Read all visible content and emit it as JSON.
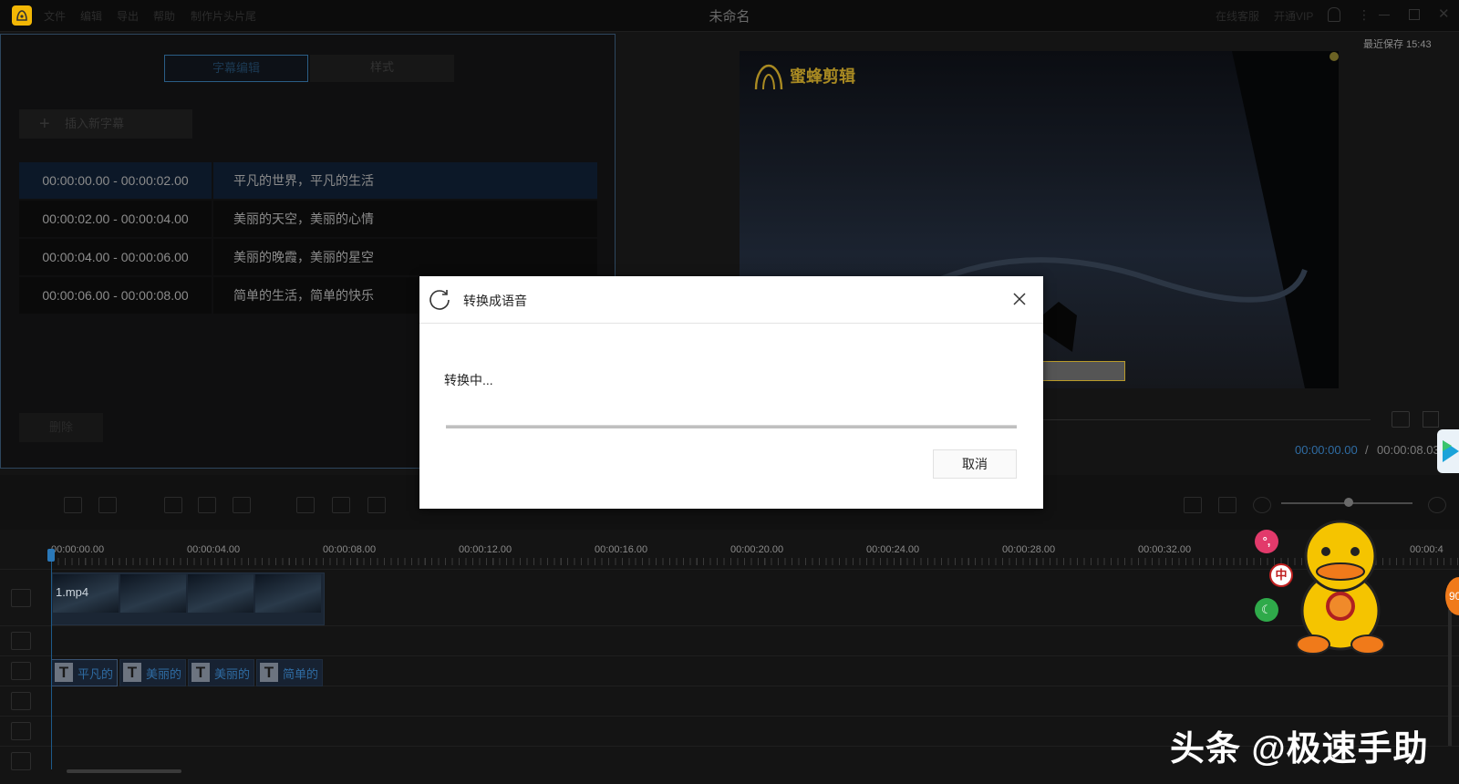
{
  "app": {
    "window_title": "未命名",
    "menu": [
      "文件",
      "编辑",
      "导出",
      "帮助",
      "制作片头片尾"
    ],
    "top_right": [
      "在线客服",
      "开通VIP"
    ],
    "last_saved": "最近保存 15:43"
  },
  "left_panel": {
    "tabs": [
      "字幕编辑",
      "样式"
    ],
    "insert_label": "插入新字幕",
    "delete_label": "删除",
    "subtitles": [
      {
        "time": "00:00:00.00 - 00:00:02.00",
        "text": "平凡的世界，平凡的生活"
      },
      {
        "time": "00:00:02.00 - 00:00:04.00",
        "text": "美丽的天空，美丽的心情"
      },
      {
        "time": "00:00:04.00 - 00:00:06.00",
        "text": "美丽的晚霞，美丽的星空"
      },
      {
        "time": "00:00:06.00 - 00:00:08.00",
        "text": "简单的生活，简单的快乐"
      }
    ]
  },
  "preview": {
    "watermark": "蜜蜂剪辑",
    "time_current": "00:00:00.00",
    "time_sep": "/",
    "time_total": "00:00:08.03"
  },
  "timeline": {
    "ruler": [
      "00:00:00.00",
      "00:00:04.00",
      "00:00:08.00",
      "00:00:12.00",
      "00:00:16.00",
      "00:00:20.00",
      "00:00:24.00",
      "00:00:28.00",
      "00:00:32.00",
      "00:00:4"
    ],
    "video_clip": "1.mp4",
    "subtitle_clips": [
      "平凡的",
      "美丽的",
      "美丽的",
      "简单的"
    ],
    "subtitle_icon": "T"
  },
  "dialog": {
    "title": "转换成语音",
    "status": "转换中...",
    "progress": 0,
    "cancel": "取消"
  },
  "overlay": {
    "watermark": "头条 @极速手助",
    "float_buttons": [
      "°,",
      "中"
    ],
    "badge": "90"
  },
  "colors": {
    "accent": "#2f6ca3",
    "logo": "#f2b705"
  }
}
